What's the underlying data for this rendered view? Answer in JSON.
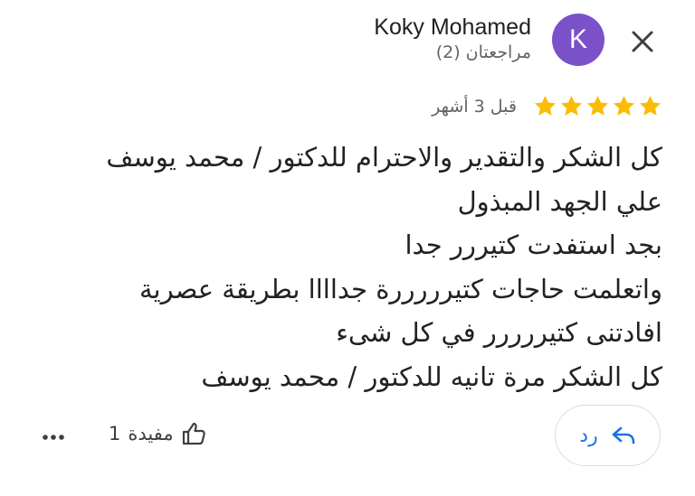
{
  "reviewer": {
    "name": "Koky Mohamed",
    "reviews_count": "مراجعتان (2)",
    "avatar_letter": "K",
    "avatar_color": "#7a51c9"
  },
  "review": {
    "rating": 5,
    "max_rating": 5,
    "time": "قبل 3 أشهر",
    "lines": [
      "كل الشكر والتقدير والاحترام للدكتور / محمد يوسف",
      "علي الجهد المبذول",
      "بجد استفدت كتيررر جدا",
      "واتعلمت حاجات كتيرررررة جداااا  بطريقة عصرية",
      "افادتنى كتيررررر في كل شىء",
      "كل الشكر مرة تانيه للدكتور / محمد يوسف"
    ]
  },
  "actions": {
    "reply_label": "رد",
    "helpful_label": "مفيدة",
    "helpful_count": "1"
  },
  "icons": {
    "close": "close-icon",
    "star": "star-icon",
    "reply": "reply-arrow-icon",
    "thumbs_up": "thumbs-up-icon",
    "more": "more-horizontal-icon"
  },
  "colors": {
    "star": "#fbbc04",
    "accent": "#1a73e8",
    "avatar": "#7a51c9"
  }
}
